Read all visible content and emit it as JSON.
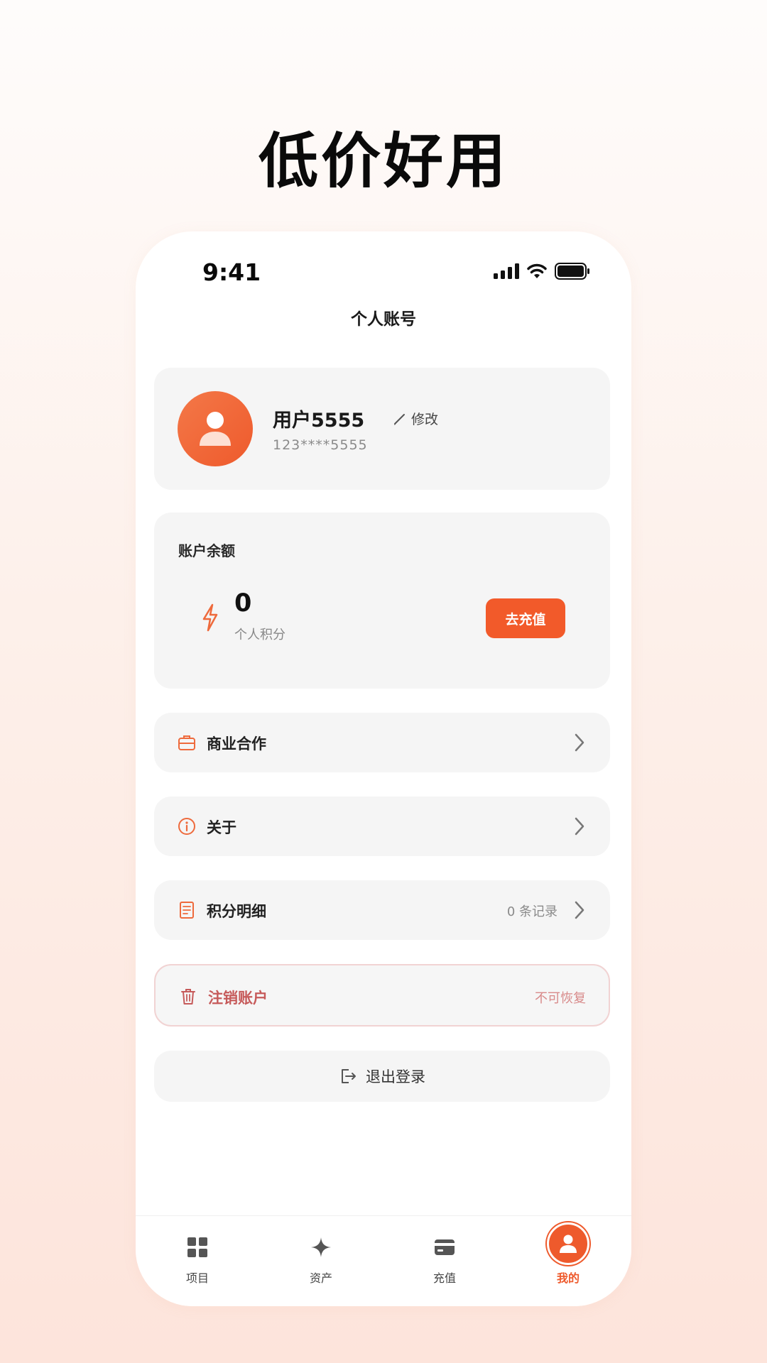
{
  "headline": "低价好用",
  "status_bar": {
    "time": "9:41"
  },
  "nav": {
    "title": "个人账号"
  },
  "profile": {
    "username": "用户5555",
    "edit_label": "修改",
    "phone": "123****5555"
  },
  "balance": {
    "label": "账户余额",
    "points_value": "0",
    "points_label": "个人积分",
    "recharge_label": "去充值"
  },
  "menu": {
    "business": {
      "label": "商业合作"
    },
    "about": {
      "label": "关于"
    },
    "points_detail": {
      "label": "积分明细",
      "extra": "0 条记录"
    },
    "delete_account": {
      "label": "注销账户",
      "extra": "不可恢复"
    },
    "logout": {
      "label": "退出登录"
    }
  },
  "tabs": [
    {
      "label": "项目",
      "icon": "grid-icon"
    },
    {
      "label": "资产",
      "icon": "sparkle-icon"
    },
    {
      "label": "充值",
      "icon": "card-icon"
    },
    {
      "label": "我的",
      "icon": "user-icon",
      "active": true
    }
  ],
  "colors": {
    "accent": "#EE5A2C",
    "danger": "#C65A5A",
    "card": "#F5F5F5"
  }
}
